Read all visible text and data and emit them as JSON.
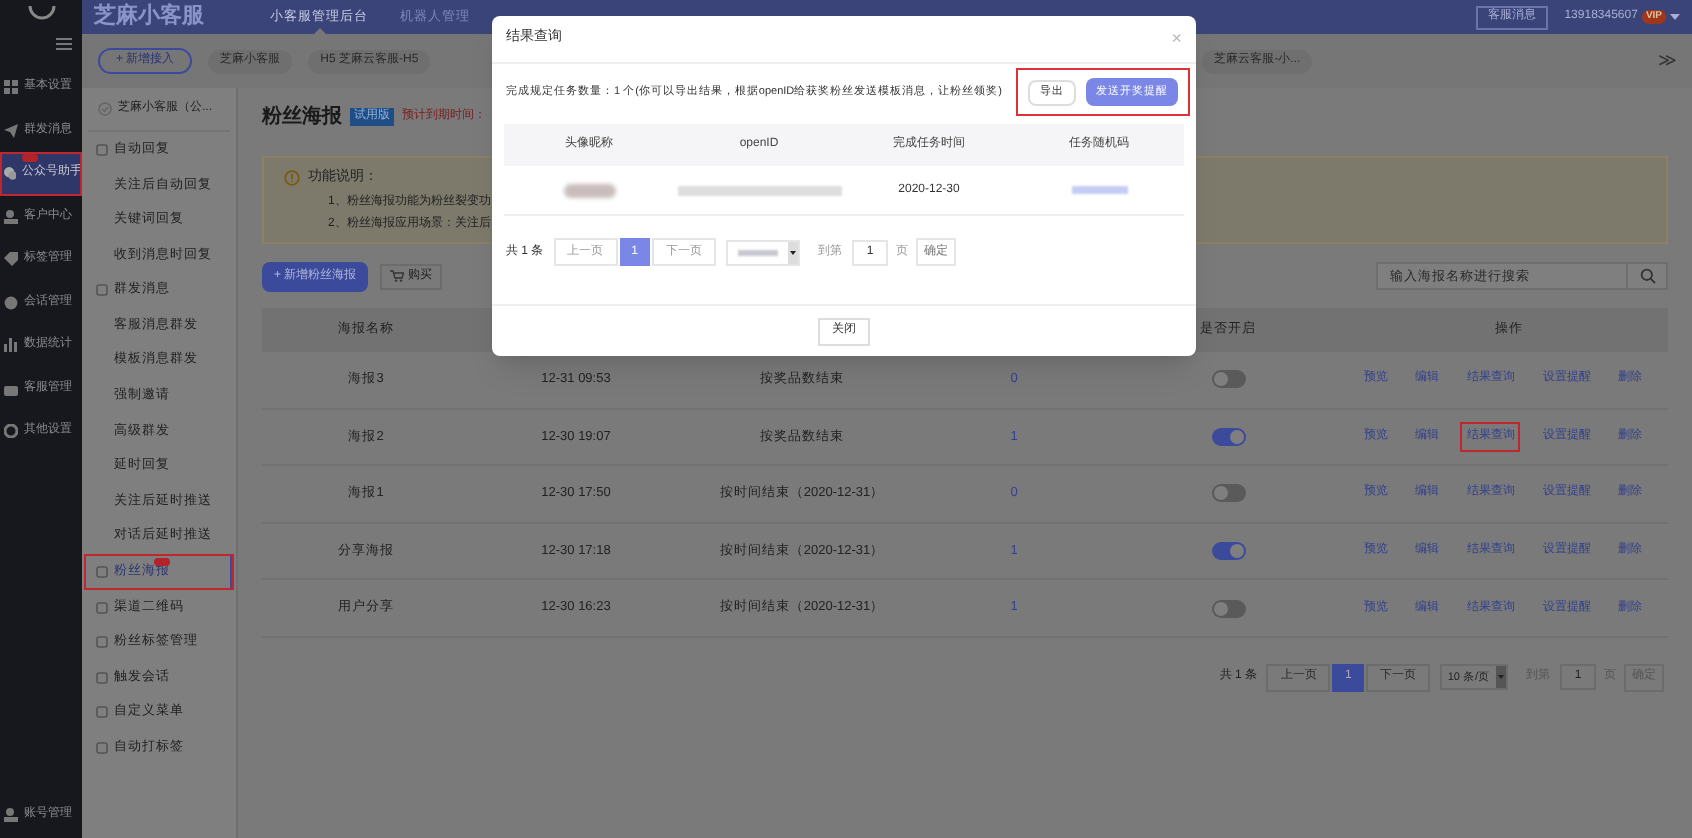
{
  "topbar": {
    "logo": "芝麻小客服",
    "tabs": [
      {
        "label": "小客服管理后台",
        "selected": true
      },
      {
        "label": "机器人管理",
        "selected": false
      }
    ],
    "service_button": "客服消息",
    "account": "13918345607",
    "vip_badge": "VIP"
  },
  "account_tabs": {
    "add_button": "+ 新增接入",
    "items": [
      "芝麻小客服",
      "H5 芝麻云客服-H5",
      "芝麻云客服-小..."
    ],
    "more": "≫"
  },
  "sidebar": {
    "items": [
      {
        "label": "基本设置",
        "selected": false,
        "highlighted": false,
        "badge": false
      },
      {
        "label": "群发消息",
        "selected": false,
        "highlighted": false,
        "badge": false
      },
      {
        "label": "公众号助手",
        "selected": true,
        "highlighted": true,
        "badge": true
      },
      {
        "label": "客户中心",
        "selected": false,
        "highlighted": false,
        "badge": false
      },
      {
        "label": "标签管理",
        "selected": false,
        "highlighted": false,
        "badge": false
      },
      {
        "label": "会话管理",
        "selected": false,
        "highlighted": false,
        "badge": false
      },
      {
        "label": "数据统计",
        "selected": false,
        "highlighted": false,
        "badge": false
      },
      {
        "label": "客服管理",
        "selected": false,
        "highlighted": false,
        "badge": false
      },
      {
        "label": "其他设置",
        "selected": false,
        "highlighted": false,
        "badge": false
      }
    ],
    "bottom_item": "账号管理"
  },
  "subnav": {
    "account": "芝麻小客服（公...",
    "menu": [
      {
        "label": "自动回复",
        "selected": false,
        "highlighted": false,
        "badge": false,
        "children": [
          {
            "label": "关注后自动回复"
          },
          {
            "label": "关键词回复"
          },
          {
            "label": "收到消息时回复"
          }
        ]
      },
      {
        "label": "群发消息",
        "selected": false,
        "highlighted": false,
        "badge": false,
        "children": [
          {
            "label": "客服消息群发"
          },
          {
            "label": "模板消息群发"
          },
          {
            "label": "强制邀请"
          },
          {
            "label": "高级群发"
          },
          {
            "label": "延时回复"
          },
          {
            "label": "关注后延时推送"
          },
          {
            "label": "对话后延时推送"
          }
        ]
      },
      {
        "label": "粉丝海报",
        "selected": true,
        "highlighted": true,
        "badge": true
      },
      {
        "label": "渠道二维码",
        "selected": false,
        "highlighted": false,
        "badge": false
      },
      {
        "label": "粉丝标签管理",
        "selected": false,
        "highlighted": false,
        "badge": false
      },
      {
        "label": "触发会话",
        "selected": false,
        "highlighted": false,
        "badge": false
      },
      {
        "label": "自定义菜单",
        "selected": false,
        "highlighted": false,
        "badge": false
      },
      {
        "label": "自动打标签",
        "selected": false,
        "highlighted": false,
        "badge": false
      }
    ]
  },
  "page": {
    "title": "粉丝海报",
    "edition_badge": "试用版",
    "expiry": "预计到期时间：",
    "notice": {
      "title": "功能说明：",
      "lines": [
        "1、粉丝海报功能为粉丝裂变功",
        "2、粉丝海报应用场景：关注后"
      ]
    },
    "add_button": "+ 新增粉丝海报",
    "buy_button": "购买",
    "search": {
      "placeholder": "输入海报名称进行搜索"
    }
  },
  "table": {
    "columns": [
      "海报名称",
      "是否开启",
      "操作"
    ],
    "rows": [
      {
        "name": "海报3",
        "time": "12-31 09:53",
        "end": "按奖品数结束",
        "count": "0",
        "enabled": false,
        "actions": [
          {
            "label": "预览",
            "highlighted": false
          },
          {
            "label": "编辑",
            "highlighted": false
          },
          {
            "label": "结果查询",
            "highlighted": false
          },
          {
            "label": "设置提醒",
            "highlighted": false
          },
          {
            "label": "删除",
            "highlighted": false
          }
        ]
      },
      {
        "name": "海报2",
        "time": "12-30 19:07",
        "end": "按奖品数结束",
        "count": "1",
        "enabled": true,
        "actions": [
          {
            "label": "预览",
            "highlighted": false
          },
          {
            "label": "编辑",
            "highlighted": false
          },
          {
            "label": "结果查询",
            "highlighted": true
          },
          {
            "label": "设置提醒",
            "highlighted": false
          },
          {
            "label": "删除",
            "highlighted": false
          }
        ]
      },
      {
        "name": "海报1",
        "time": "12-30 17:50",
        "end": "按时间结束（2020-12-31）",
        "count": "0",
        "enabled": false,
        "actions": [
          {
            "label": "预览",
            "highlighted": false
          },
          {
            "label": "编辑",
            "highlighted": false
          },
          {
            "label": "结果查询",
            "highlighted": false
          },
          {
            "label": "设置提醒",
            "highlighted": false
          },
          {
            "label": "删除",
            "highlighted": false
          }
        ]
      },
      {
        "name": "分享海报",
        "time": "12-30 17:18",
        "end": "按时间结束（2020-12-31）",
        "count": "1",
        "enabled": true,
        "actions": [
          {
            "label": "预览",
            "highlighted": false
          },
          {
            "label": "编辑",
            "highlighted": false
          },
          {
            "label": "结果查询",
            "highlighted": false
          },
          {
            "label": "设置提醒",
            "highlighted": false
          },
          {
            "label": "删除",
            "highlighted": false
          }
        ]
      },
      {
        "name": "用户分享",
        "time": "12-30 16:23",
        "end": "按时间结束（2020-12-31）",
        "count": "1",
        "enabled": false,
        "actions": [
          {
            "label": "预览",
            "highlighted": false
          },
          {
            "label": "编辑",
            "highlighted": false
          },
          {
            "label": "结果查询",
            "highlighted": false
          },
          {
            "label": "设置提醒",
            "highlighted": false
          },
          {
            "label": "删除",
            "highlighted": false
          }
        ]
      }
    ],
    "pagination": {
      "total": "共 1 条",
      "prev": "上一页",
      "page": "1",
      "next": "下一页",
      "page_size": "10 条/页",
      "goto": "到第",
      "goto_value": "1",
      "page_unit": "页",
      "confirm": "确定"
    }
  },
  "dialog": {
    "title": "结果查询",
    "close": "×",
    "summary": "完成规定任务数量：1 个(你可以导出结果，根据openID给获奖粉丝发送模板消息，让粉丝领奖)",
    "actions_highlighted": true,
    "export_button": "导出",
    "notify_button": "发送开奖提醒",
    "columns": [
      "头像昵称",
      "openID",
      "完成任务时间",
      "任务随机码"
    ],
    "rows": [
      {
        "date": "2020-12-30"
      }
    ],
    "pagination": {
      "total": "共 1 条",
      "prev": "上一页",
      "page": "1",
      "next": "下一页",
      "goto": "到第",
      "goto_value": "1",
      "page_unit": "页",
      "confirm": "确定"
    },
    "close_button": "关闭"
  }
}
